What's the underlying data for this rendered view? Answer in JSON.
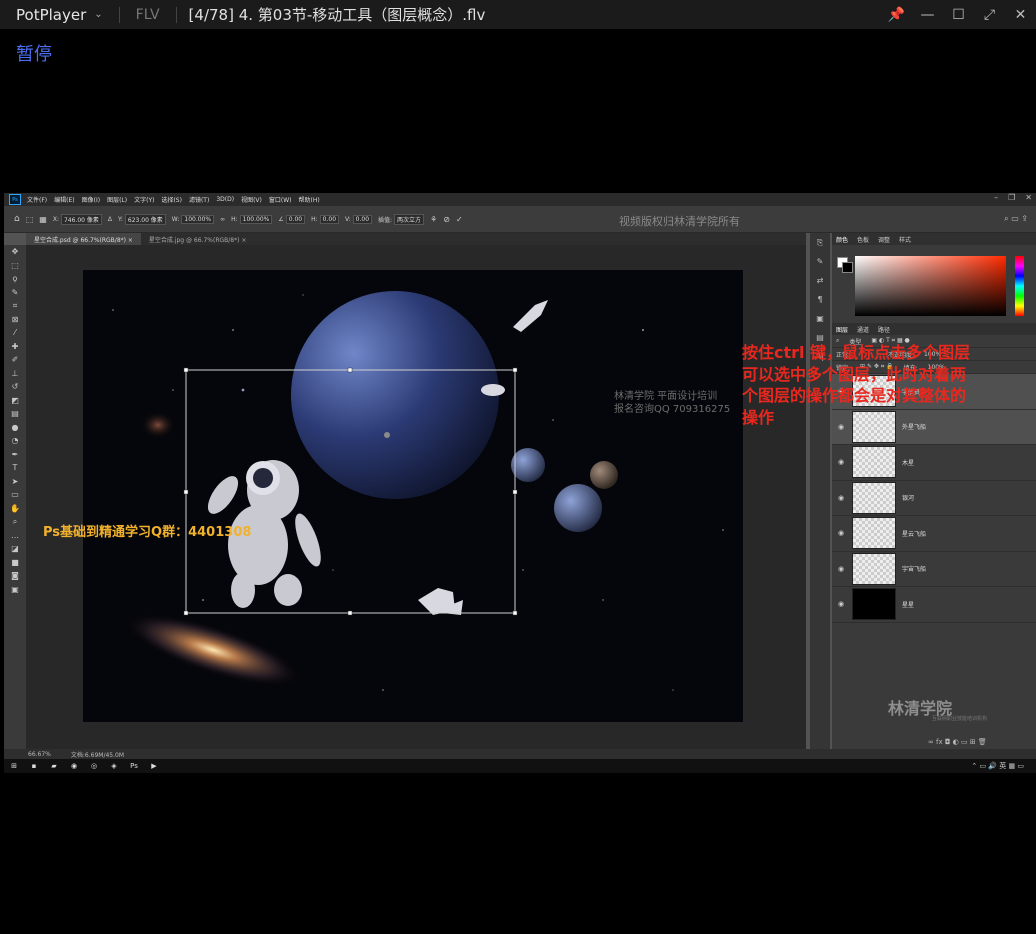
{
  "player": {
    "brand": "PotPlayer",
    "format": "FLV",
    "title": "[4/78] 4. 第03节-移动工具（图层概念）.flv",
    "status": "暂停"
  },
  "ps": {
    "menu": [
      "文件(F)",
      "编辑(E)",
      "图像(I)",
      "图层(L)",
      "文字(Y)",
      "选择(S)",
      "滤镜(T)",
      "3D(D)",
      "视图(V)",
      "窗口(W)",
      "帮助(H)"
    ],
    "options": {
      "x_label": "X:",
      "x_value": "746.00 像素",
      "y_label": "Y:",
      "y_value": "623.00 像素",
      "w_label": "W:",
      "w_value": "100.00%",
      "h_label": "H:",
      "h_value": "100.00%",
      "angle_value": "0.00",
      "hskew_label": "H:",
      "hskew_value": "0.00",
      "vskew_label": "V:",
      "vskew_value": "0.00",
      "interp_label": "插值:",
      "interp_value": "两次立方"
    },
    "watermark_top": "视频版权归林清学院所有",
    "tabs": [
      "星空合成.psd @ 66.7%(RGB/8*) ×",
      "星空合成.jpg @ 66.7%(RGB/8*) ×"
    ],
    "panel_tabs_color": [
      "颜色",
      "色板",
      "调整",
      "样式"
    ],
    "panel_tabs_layers": [
      "图层",
      "通道",
      "路径"
    ],
    "layer_filter": "类型",
    "blend_mode": "正常",
    "opacity_label": "不透明度:",
    "opacity_value": "100%",
    "lock_label": "锁定:",
    "fill_label": "填充:",
    "fill_value": "100%",
    "layers": [
      {
        "name": "宇航员",
        "selected": true
      },
      {
        "name": "外星飞船",
        "selected": true
      },
      {
        "name": "木星",
        "selected": false
      },
      {
        "name": "银河",
        "selected": false
      },
      {
        "name": "星云飞船",
        "selected": false
      },
      {
        "name": "宇宙飞船",
        "selected": false
      },
      {
        "name": "星星",
        "selected": false
      }
    ],
    "watermark_logo": "林清学院",
    "watermark_logo_sub": "互联网职业技能培训机构",
    "status_zoom": "66.67%",
    "status_doc": "文档:6.69M/45.0M",
    "watermark_mid": "林清学院  平面设计培训\n报名咨询QQ 709316275",
    "tray": "英"
  },
  "overlay": {
    "red_note": "按住ctrl 键，鼠标点击多个图层\n可以选中多个图层，此时对着两\n个图层的操作都会是对其整体的\n操作",
    "yellow_note": "Ps基础到精通学习Q群：4401308"
  },
  "colors": {
    "pause_text": "#4b6ff0",
    "red_note": "#e8281e",
    "yellow_note": "#f2b12c"
  }
}
